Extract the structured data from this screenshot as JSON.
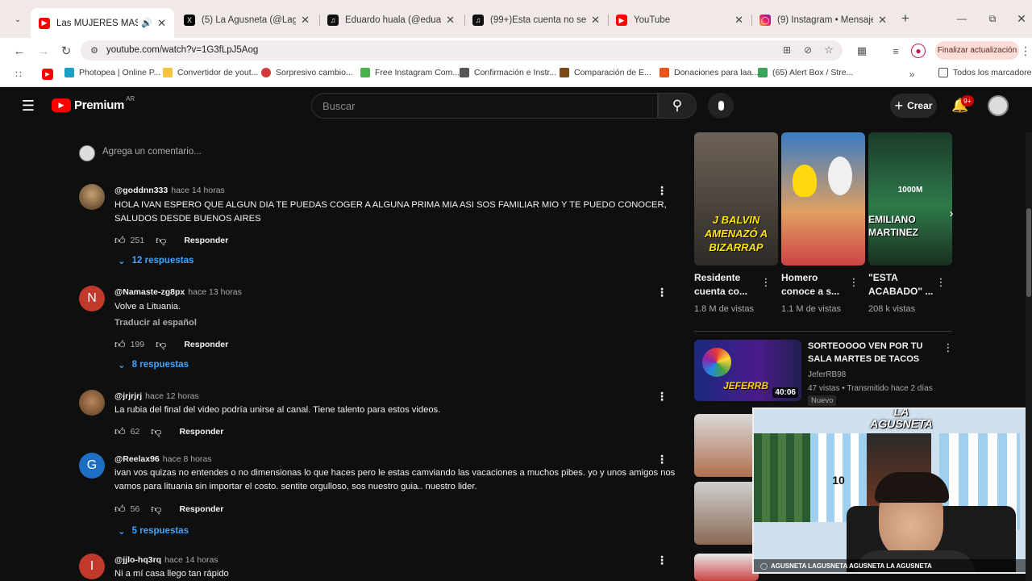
{
  "browser": {
    "tabs": [
      {
        "title": "Las MUJERES MÁS LINDA",
        "icon": "youtube-icon",
        "active": true
      },
      {
        "title": "(5) La Agusneta (@Lagusnet",
        "icon": "x-icon"
      },
      {
        "title": "Eduardo huala (@eduardo.h",
        "icon": "tiktok-icon"
      },
      {
        "title": "(99+)Esta cuenta no se encu",
        "icon": "tiktok-icon"
      },
      {
        "title": "YouTube",
        "icon": "youtube-icon"
      },
      {
        "title": "(9) Instagram • Mensajes",
        "icon": "instagram-icon"
      }
    ],
    "url": "youtube.com/watch?v=1G3fLpJ5Aog",
    "update_button": "Finalizar actualización",
    "bookmarks": [
      {
        "label": "Photopea | Online P...",
        "color": "#1aa0c4"
      },
      {
        "label": "Convertidor de yout...",
        "color": "#f5c33b"
      },
      {
        "label": "Sorpresivo cambio...",
        "color": "#d23a3a"
      },
      {
        "label": "Free Instagram Com...",
        "color": "#4caf50"
      },
      {
        "label": "Confirmación e Instr...",
        "color": "#555555"
      },
      {
        "label": "Comparación de E...",
        "color": "#7a4a1a"
      },
      {
        "label": "Donaciones para laa...",
        "color": "#e8541a"
      },
      {
        "label": "(65) Alert Box / Stre...",
        "color": "#3aa55a"
      }
    ],
    "all_bookmarks": "Todos los marcadores"
  },
  "yt": {
    "logo_text": "Premium",
    "logo_region": "AR",
    "search_placeholder": "Buscar",
    "create_label": "Crear",
    "notif_badge": "9+",
    "add_comment_placeholder": "Agrega un comentario..."
  },
  "comments": [
    {
      "user": "@goddnn333",
      "time": "hace 14 horas",
      "text": "HOLA IVAN ESPERO QUE ALGUN DIA TE PUEDAS COGER A ALGUNA PRIMA MIA ASI SOS FAMILIAR MIO Y TE PUEDO CONOCER, SALUDOS DESDE BUENOS AIRES",
      "likes": "251",
      "reply_label": "Responder",
      "replies": "12 respuestas"
    },
    {
      "user": "@Namaste-zg8px",
      "time": "hace 13 horas",
      "text": "Volve a Lituania.",
      "translate": "Traducir al español",
      "avatar_letter": "N",
      "likes": "199",
      "reply_label": "Responder",
      "replies": "8 respuestas"
    },
    {
      "user": "@jrjrjrj",
      "time": "hace 12 horas",
      "text": "La rubia del final del video podría unirse al canal. Tiene talento para estos videos.",
      "likes": "62",
      "reply_label": "Responder"
    },
    {
      "user": "@Reelax96",
      "time": "hace 8 horas",
      "text": "ivan vos quizas no entendes o no dimensionas lo que haces pero le estas camviando las vacaciones a muchos pibes. yo y unos amigos nos vamos para lituania  sin importar el costo. sentite orgulloso, sos nuestro guia.. nuestro lider.",
      "avatar_letter": "G",
      "likes": "56",
      "reply_label": "Responder",
      "replies": "5 respuestas"
    },
    {
      "user": "@jjlo-hq3rq",
      "time": "hace 14 horas",
      "text": "Ni a mí casa llego tan rápido",
      "avatar_letter": "I"
    }
  ],
  "shorts": [
    {
      "title": "Residente cuenta co...",
      "views": "1.8 M de vistas",
      "thumb_text": "J BALVIN AMENAZÓ A BIZARRAP"
    },
    {
      "title": "Homero conoce a s...",
      "views": "1.1 M de vistas"
    },
    {
      "title": "\"ESTA ACABADO\" ...",
      "views": "208 k vistas",
      "thumb_text": "EMILIANO MARTINEZ",
      "thumb_top": "1000M"
    }
  ],
  "related": {
    "title": "SORTEOOOO VEN POR TU SALA MARTES DE TACOS",
    "channel": "JeferRB98",
    "meta": "47 vistas • Transmitido hace 2 días",
    "badge": "Nuevo",
    "duration": "40:06",
    "thumb_text": "JEFERRB"
  },
  "overlay": {
    "brand": "LA AGUSNETA",
    "socials": "AGUSNETA  LAGUSNETA  AGUSNETA  LA AGUSNETA",
    "jersey_number": "10"
  }
}
